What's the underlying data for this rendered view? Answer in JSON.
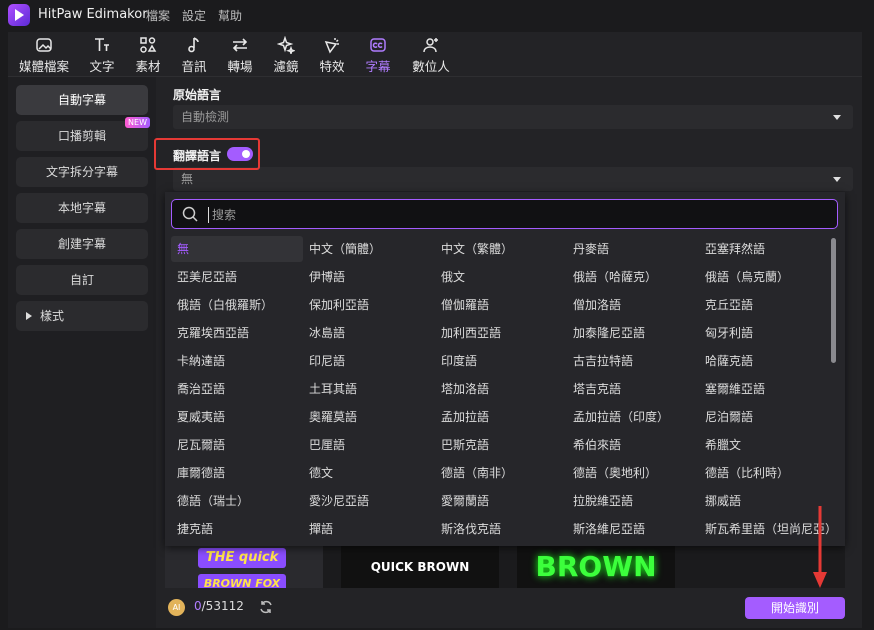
{
  "app": {
    "title": "HitPaw Edimakor",
    "menus": [
      "檔案",
      "設定",
      "幫助"
    ]
  },
  "toolbar": {
    "tabs": [
      {
        "label": "媒體檔案",
        "icon": "media-icon"
      },
      {
        "label": "文字",
        "icon": "text-icon"
      },
      {
        "label": "素材",
        "icon": "assets-icon"
      },
      {
        "label": "音訊",
        "icon": "audio-icon"
      },
      {
        "label": "轉場",
        "icon": "transition-icon"
      },
      {
        "label": "濾鏡",
        "icon": "filter-icon"
      },
      {
        "label": "特效",
        "icon": "effects-icon"
      },
      {
        "label": "字幕",
        "icon": "subtitle-icon",
        "active": true
      },
      {
        "label": "數位人",
        "icon": "avatar-icon"
      }
    ]
  },
  "sidebar": {
    "items": [
      {
        "label": "自動字幕",
        "active": true
      },
      {
        "label": "口播剪輯",
        "badge": "NEW"
      },
      {
        "label": "文字拆分字幕"
      },
      {
        "label": "本地字幕"
      },
      {
        "label": "創建字幕"
      },
      {
        "label": "自訂"
      },
      {
        "label": "樣式"
      }
    ]
  },
  "form": {
    "original_language_label": "原始語言",
    "original_language_value": "自動檢測",
    "translate_label": "翻譯語言",
    "translate_enabled": true,
    "translate_value": "無"
  },
  "dropdown": {
    "search_placeholder": "搜索",
    "languages": [
      "無",
      "中文（簡體）",
      "中文（繁體）",
      "丹麥語",
      "亞塞拜然語",
      "亞美尼亞語",
      "伊博語",
      "俄文",
      "俄語（哈薩克）",
      "俄語（烏克蘭）",
      "俄語（白俄羅斯）",
      "保加利亞語",
      "僧伽羅語",
      "僧加洛語",
      "克丘亞語",
      "克羅埃西亞語",
      "冰島語",
      "加利西亞語",
      "加泰隆尼亞語",
      "匈牙利語",
      "卡納達語",
      "印尼語",
      "印度語",
      "古吉拉特語",
      "哈薩克語",
      "喬治亞語",
      "土耳其語",
      "塔加洛語",
      "塔吉克語",
      "塞爾維亞語",
      "夏威夷語",
      "奧羅莫語",
      "孟加拉語",
      "孟加拉語（印度）",
      "尼泊爾語",
      "尼瓦爾語",
      "巴厘語",
      "巴斯克語",
      "希伯來語",
      "希臘文",
      "庫爾德語",
      "德文",
      "德語（南非）",
      "德語（奧地利）",
      "德語（比利時）",
      "德語（瑞士）",
      "愛沙尼亞語",
      "愛爾蘭語",
      "拉脫維亞語",
      "挪威語",
      "捷克語",
      "撣語",
      "斯洛伐克語",
      "斯洛維尼亞語",
      "斯瓦希里語（坦尚尼亞）"
    ],
    "selected": "無"
  },
  "preview": {
    "thumb1_line1": "THE quick",
    "thumb1_line2": "BROWN FOX",
    "thumb2": "QUICK BROWN",
    "thumb3": "BROWN"
  },
  "footer": {
    "coin_label": "AI",
    "used": "0",
    "total": "/53112",
    "start_button": "開始識別"
  },
  "colors": {
    "accent": "#a45cff",
    "highlight": "#e53935"
  }
}
